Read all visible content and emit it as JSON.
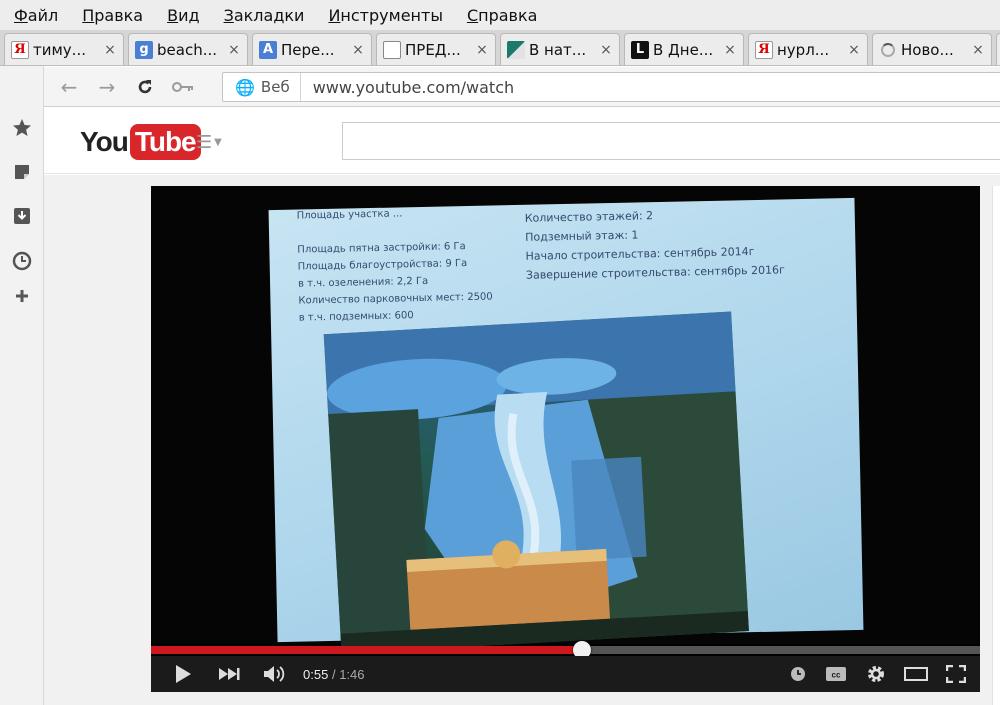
{
  "menu": [
    "Файл",
    "Правка",
    "Вид",
    "Закладки",
    "Инструменты",
    "Справка"
  ],
  "tabs": [
    {
      "title": "тиму...",
      "favicon": "yandex-icon",
      "fav_text": "Я",
      "close": "×"
    },
    {
      "title": "beach...",
      "favicon": "google-icon",
      "fav_text": "g",
      "close": "×"
    },
    {
      "title": "Пере...",
      "favicon": "translate-icon",
      "fav_text": "A",
      "close": "×"
    },
    {
      "title": "ПРЕД...",
      "favicon": "document-icon",
      "fav_text": "",
      "close": "×"
    },
    {
      "title": "В нат...",
      "favicon": "site-icon",
      "fav_text": "",
      "close": "×"
    },
    {
      "title": "В Дне...",
      "favicon": "letter-l-icon",
      "fav_text": "L",
      "close": "×"
    },
    {
      "title": "нурл...",
      "favicon": "yandex-icon",
      "fav_text": "Я",
      "close": "×"
    },
    {
      "title": "Ново...",
      "favicon": "loading-icon",
      "fav_text": "",
      "close": "×"
    }
  ],
  "address": {
    "scheme_label": "Веб",
    "url": "www.youtube.com/watch"
  },
  "youtube": {
    "logo_you": "You",
    "logo_tube": "Tube"
  },
  "slide": {
    "left_col": "Площадь участка ...\n\nПлощадь пятна застройки: 6 Га\nПлощадь благоустройства: 9 Га\nв т.ч. озеленения: 2,2 Га\nКоличество парковочных мест: 2500\nв т.ч. подземных: 600",
    "right_col": "Количество этажей: 2\nПодземный этаж: 1\nНачало строительства: сентябрь 2014г\nЗавершение строительства: сентябрь 2016г"
  },
  "player": {
    "current_time": "0:55",
    "separator": "/",
    "duration": "1:46",
    "progress_fraction": 0.52,
    "accent": "#cc181e"
  }
}
